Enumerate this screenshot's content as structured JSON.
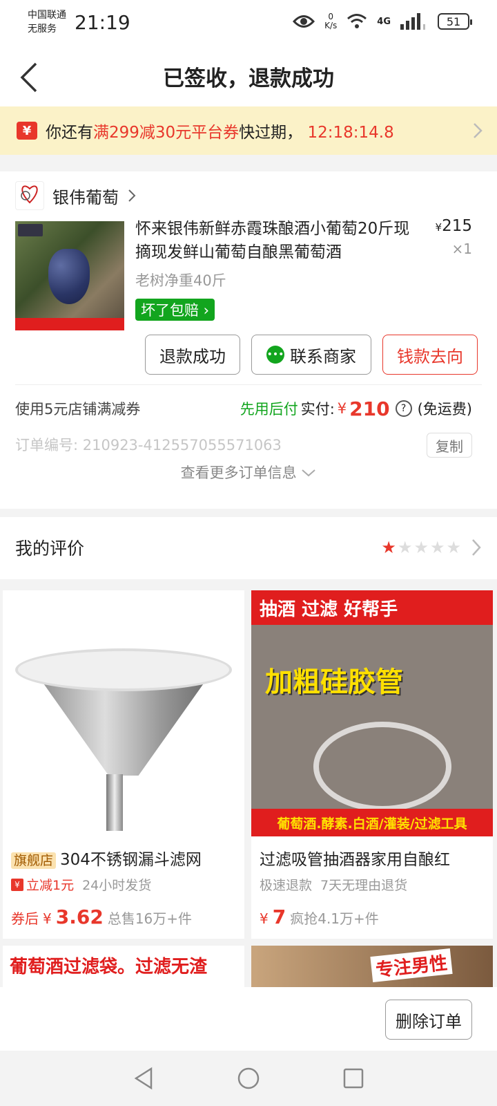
{
  "status_bar": {
    "carrier_line1": "中国联通",
    "carrier_line2": "无服务",
    "time": "21:19",
    "net_speed_value": "0",
    "net_speed_unit": "K/s",
    "network": "4G",
    "battery": "51"
  },
  "nav": {
    "title": "已签收，退款成功"
  },
  "coupon_banner": {
    "prefix": "你还有",
    "highlight": "满299减30元平台券",
    "suffix": "快过期，",
    "countdown": "12:18:14.8",
    "icon_char": "¥"
  },
  "order": {
    "shop_name": "银伟葡萄",
    "product_title": "怀来银伟新鲜赤霞珠酿酒小葡萄20斤现摘现发鲜山葡萄自酿黑葡萄酒",
    "spec": "老树净重40斤",
    "currency": "¥",
    "price": "215",
    "quantity": "×1",
    "guarantee_badge": "坏了包赔",
    "buttons": {
      "refund": "退款成功",
      "contact": "联系商家",
      "money_flow": "钱款去向"
    },
    "coupon_used": "使用5元店铺满减券",
    "pay_later": "先用后付",
    "paid_label": "实付:",
    "paid_amount": "210",
    "shipping": "(免运费)",
    "order_no": "订单编号:  210923-412557055571063",
    "copy": "复制",
    "more_info": "查看更多订单信息"
  },
  "review": {
    "label": "我的评价",
    "rating": 1,
    "max": 5
  },
  "recommendations": [
    {
      "flag": "旗舰店",
      "title": "304不锈钢漏斗滤网",
      "promo": "立减1元",
      "promo_icon": "¥",
      "ship": "24小时发货",
      "price_prefix": "券后",
      "currency": "¥",
      "price": "3.62",
      "sales": "总售16万+件"
    },
    {
      "image_header": "抽酒 过滤 好帮手",
      "image_big": "加粗硅胶管",
      "image_footer": "葡萄酒.酵素.白酒/灌装/过滤工具",
      "title": "过滤吸管抽酒器家用自酿红",
      "tag1": "极速退款",
      "tag2": "7天无理由退货",
      "currency": "¥",
      "price": "7",
      "sales": "疯抢4.1万+件"
    }
  ],
  "more_recs": {
    "left_banner": "葡萄酒过滤袋。过滤无渣",
    "right_banner": "专注男性"
  },
  "action_bar": {
    "delete": "删除订单"
  }
}
